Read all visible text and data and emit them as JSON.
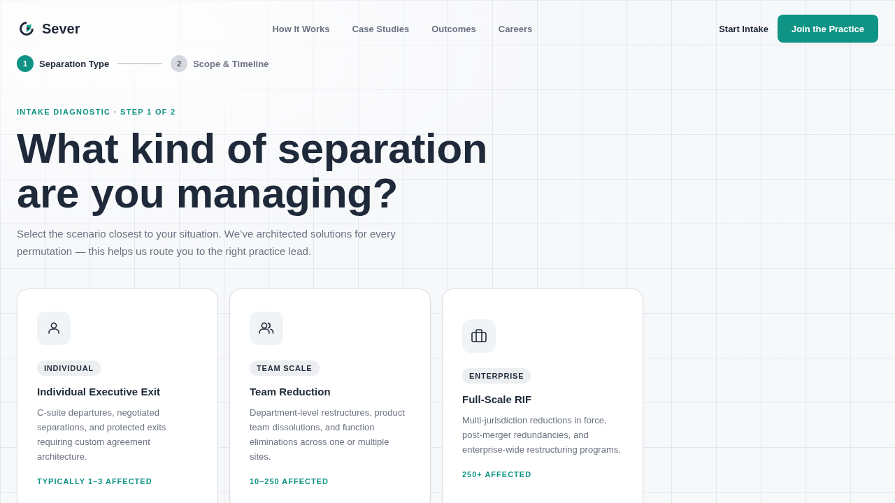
{
  "brand": {
    "name": "Sever"
  },
  "nav": {
    "links": [
      "How It Works",
      "Case Studies",
      "Outcomes",
      "Careers"
    ],
    "secondary_action": "Start Intake",
    "primary_action": "Join the Practice"
  },
  "stepper": [
    {
      "number": "1",
      "label": "Separation Type",
      "active": true
    },
    {
      "number": "2",
      "label": "Scope & Timeline",
      "active": false
    }
  ],
  "hero": {
    "eyebrow": "INTAKE DIAGNOSTIC · STEP 1 OF 2",
    "heading": "What kind of separation are you managing?",
    "intro": "Select the scenario closest to your situation. We’ve architected solutions for every permutation — this helps us route you to the right practice lead."
  },
  "options": [
    {
      "kind": "individual",
      "badge": "INDIVIDUAL",
      "title": "Individual Executive Exit",
      "description": "C-suite departures, negotiated separations, and protected exits requiring custom agreement architecture.",
      "range": "TYPICALLY 1–3 AFFECTED",
      "selected": false
    },
    {
      "kind": "team",
      "badge": "TEAM SCALE",
      "title": "Team Reduction",
      "description": "Department-level restructures, product team dissolutions, and function eliminations across one or multiple sites.",
      "range": "10–250 AFFECTED",
      "selected": false
    },
    {
      "kind": "enterprise",
      "badge": "ENTERPRISE",
      "title": "Full-Scale RIF",
      "description": "Multi-jurisdiction reductions in force, post-merger redundancies, and enterprise-wide restructuring programs.",
      "range": "250+ AFFECTED",
      "selected": false
    }
  ]
}
